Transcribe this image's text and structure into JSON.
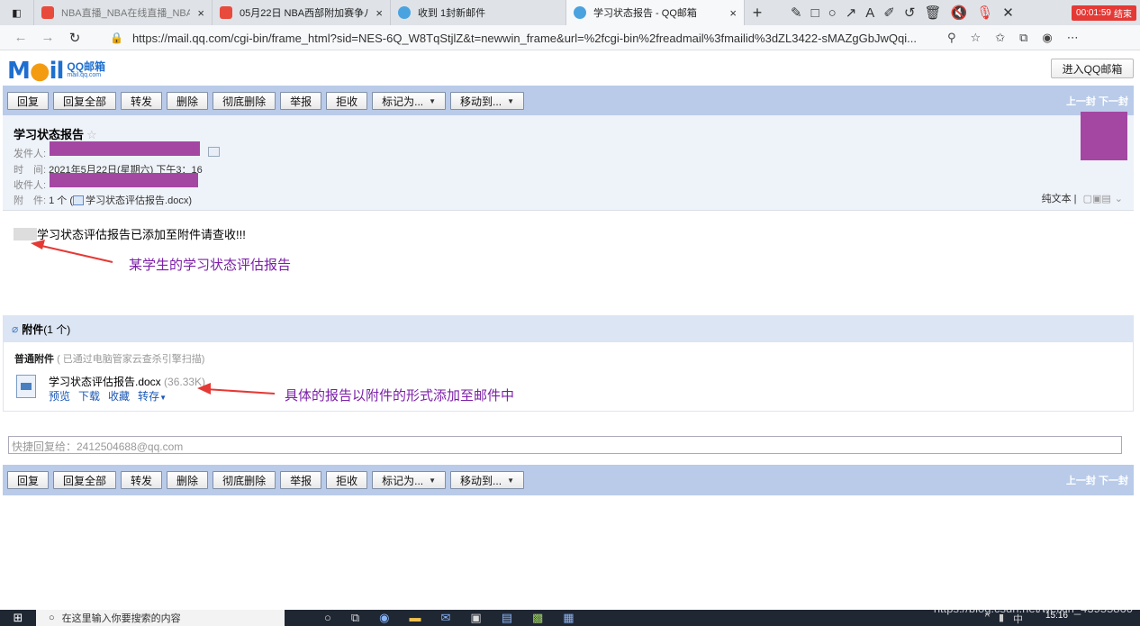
{
  "browser": {
    "tabs": [
      {
        "title": "NBA直播_NBA在线直播_NBA视",
        "color": "#e84b3c",
        "active": false
      },
      {
        "title": "05月22日 NBA西部附加赛争八 ",
        "color": "#e84b3c",
        "active": false
      },
      {
        "title": "收到 1封新邮件",
        "color": "#4aa3df",
        "active": false
      },
      {
        "title": "学习状态报告 - QQ邮箱",
        "color": "#4aa3df",
        "active": true
      }
    ],
    "tab_close": "×",
    "new_tab": "+",
    "url": "https://mail.qq.com/cgi-bin/frame_html?sid=NES-6Q_W8TqStjlZ&t=newwin_frame&url=%2fcgi-bin%2freadmail%3fmailid%3dZL3422-sMAZgGbJwQqi...",
    "recording_time": "00:01:59",
    "recording_end": "结束"
  },
  "mail": {
    "logo_text": "QQ邮箱",
    "logo_sub": "mail.qq.com",
    "enter_button": "进入QQ邮箱",
    "toolbar": {
      "reply": "回复",
      "reply_all": "回复全部",
      "forward": "转发",
      "delete": "删除",
      "delete_forever": "彻底删除",
      "report": "举报",
      "reject": "拒收",
      "mark_as": "标记为...",
      "move_to": "移动到...",
      "prev": "上一封",
      "next": "下一封"
    },
    "subject": "学习状态报告",
    "sender_label": "发件人:",
    "time_label": "时　间:",
    "time_value": "2021年5月22日(星期六) 下午3：16",
    "recipient_label": "收件人:",
    "attachment_label": "附　件:",
    "attachment_count": "1 个 (",
    "attachment_inline_name": "学习状态评估报告.docx)",
    "plain_text": "纯文本",
    "body_text": "学习状态评估报告已添加至附件请查收!!!",
    "annotation_1": "某学生的学习状态评估报告",
    "attachments_title": "附件",
    "attachments_count": "(1 个)",
    "attach_type": "普通附件",
    "attach_scan": "( 已通过电脑管家云查杀引擎扫描)",
    "file_name": "学习状态评估报告.docx",
    "file_size": "(36.33K)",
    "file_actions": {
      "preview": "预览",
      "download": "下载",
      "collect": "收藏",
      "save_to": "转存"
    },
    "annotation_2": "具体的报告以附件的形式添加至邮件中",
    "quick_reply_placeholder": "快捷回复给：2412504688@qq.com"
  },
  "taskbar": {
    "search_placeholder": "在这里输入你要搜索的内容",
    "clock": "15:16",
    "tray_lang": "中"
  },
  "watermark": "https://blog.csdn.net/weixin_43955860"
}
